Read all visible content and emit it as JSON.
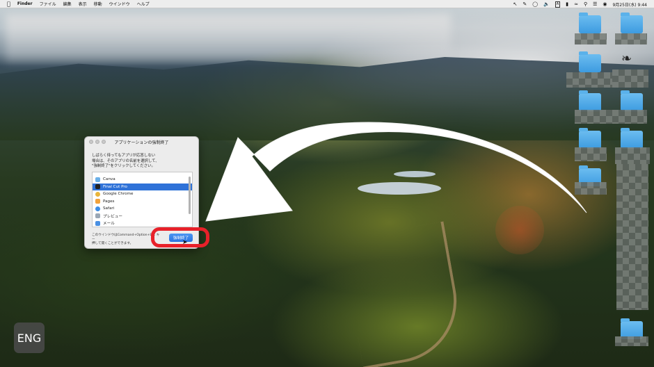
{
  "menubar": {
    "app": "Finder",
    "items": [
      "ファイル",
      "編集",
      "表示",
      "移動",
      "ウインドウ",
      "ヘルプ"
    ],
    "clock": "9月25日(水) 9:44",
    "input_indicator": "A"
  },
  "dialog": {
    "title": "アプリケーションの強制終了",
    "message_lines": [
      "しばらく待ってもアプリが応答しない",
      "場合は、そのアプリの名前を選択して、",
      "\"強制終了\"をクリックしてください。"
    ],
    "apps": [
      {
        "name": "Canva",
        "icon": "canva-icon",
        "color": "#6bb0e8"
      },
      {
        "name": "Final Cut Pro",
        "icon": "final-cut-pro-icon",
        "color": "#222222",
        "selected": true
      },
      {
        "name": "Google Chrome",
        "icon": "chrome-icon",
        "color": "#e9b53a"
      },
      {
        "name": "Pages",
        "icon": "pages-icon",
        "color": "#f2a23b"
      },
      {
        "name": "Safari",
        "icon": "safari-icon",
        "color": "#3c8de6"
      },
      {
        "name": "プレビュー",
        "icon": "preview-icon",
        "color": "#9aa7b5"
      },
      {
        "name": "メール",
        "icon": "mail-icon",
        "color": "#4a90e2"
      }
    ],
    "footer_lines": [
      "このウインドウはCommand+Option+Esc キー",
      "押して開くことができます。"
    ],
    "force_quit_label": "強制終了"
  },
  "badge": {
    "label": "ENG"
  },
  "colors": {
    "highlight": "#e8212a",
    "accent": "#2f72d8",
    "arrow": "#ffffff"
  }
}
